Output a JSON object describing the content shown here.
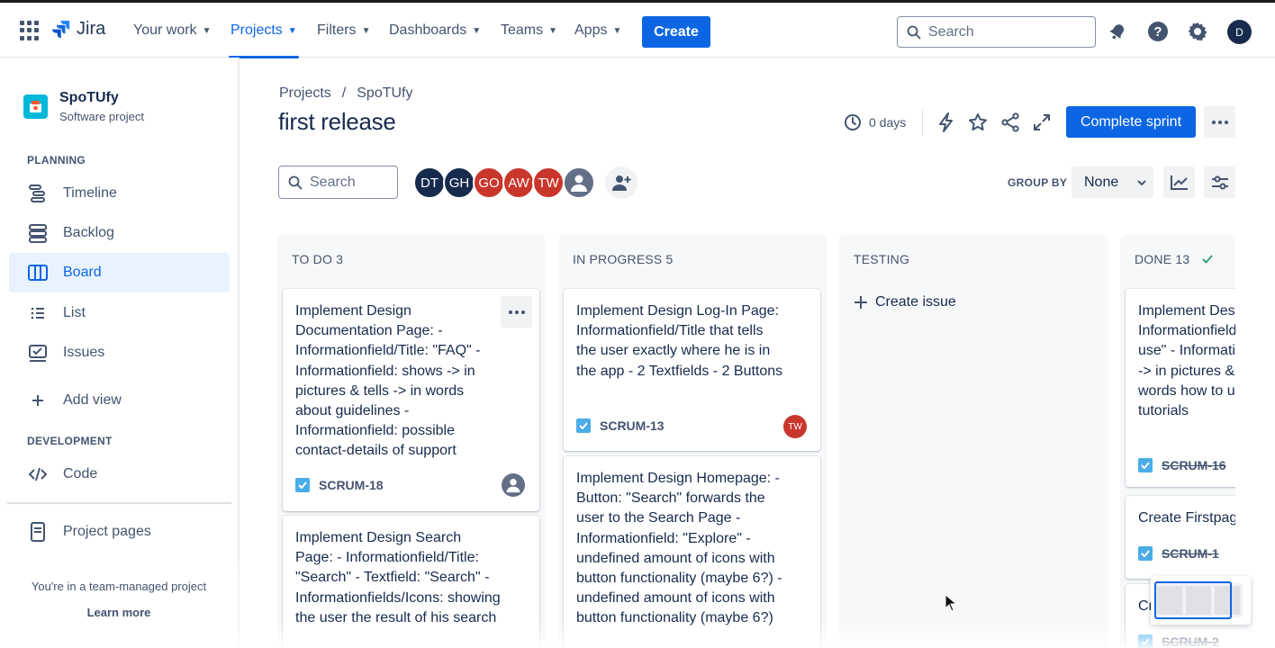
{
  "nav": {
    "logo": "Jira",
    "items": [
      {
        "label": "Your work",
        "active": false
      },
      {
        "label": "Projects",
        "active": true
      },
      {
        "label": "Filters",
        "active": false
      },
      {
        "label": "Dashboards",
        "active": false
      },
      {
        "label": "Teams",
        "active": false
      },
      {
        "label": "Apps",
        "active": false
      }
    ],
    "create_label": "Create",
    "search_placeholder": "Search",
    "avatar_initial": "D",
    "icons": [
      "notifications-icon",
      "help-icon",
      "settings-icon"
    ]
  },
  "sidebar": {
    "project_name": "SpoTUfy",
    "project_type": "Software project",
    "planning_title": "PLANNING",
    "planning_items": [
      {
        "label": "Timeline",
        "icon": "timeline-icon"
      },
      {
        "label": "Backlog",
        "icon": "backlog-icon"
      },
      {
        "label": "Board",
        "icon": "board-icon",
        "active": true
      },
      {
        "label": "List",
        "icon": "list-icon"
      },
      {
        "label": "Issues",
        "icon": "issues-icon"
      }
    ],
    "add_view": "Add view",
    "development_title": "DEVELOPMENT",
    "code": "Code",
    "project_pages": "Project pages",
    "team_note": "You're in a team-managed project",
    "learn_more": "Learn more"
  },
  "header": {
    "breadcrumb_projects": "Projects",
    "breadcrumb_sep": "/",
    "breadcrumb_project": "SpoTUfy",
    "title": "first release",
    "days": "0 days",
    "complete_sprint": "Complete sprint"
  },
  "filters": {
    "search_placeholder": "Search",
    "avatars": [
      {
        "initials": "DT",
        "color": "#172b4d"
      },
      {
        "initials": "GH",
        "color": "#172b4d"
      },
      {
        "initials": "GO",
        "color": "#c9372c"
      },
      {
        "initials": "AW",
        "color": "#c9372c"
      },
      {
        "initials": "TW",
        "color": "#c9372c"
      }
    ],
    "group_by_label": "GROUP BY",
    "group_by_value": "None"
  },
  "columns": [
    {
      "title": "TO DO 3",
      "cards": [
        {
          "text": "Implement Design Documentation Page: - Informationfield/Title: \"FAQ\" - Informationfield: shows -> in pictures & tells -> in words about guidelines - Informationfield: possible contact-details of support",
          "key": "SCRUM-18",
          "assignee": "unassigned"
        },
        {
          "text": "Implement Design Search Page: - Informationfield/Title: \"Search\" - Textfield: \"Search\" - Informationfields/Icons: showing the user the result of his search",
          "key": "",
          "assignee": ""
        }
      ]
    },
    {
      "title": "IN PROGRESS 5",
      "cards": [
        {
          "text": "Implement Design Log-In Page: Informationfield/Title that tells the user exactly where he is in the app - 2 Textfields - 2 Buttons",
          "key": "SCRUM-13",
          "assignee": "TW"
        },
        {
          "text": "Implement Design Homepage: - Button: \"Search\" forwards the user to the Search Page - Informationfield: \"Explore\" - undefined amount of icons with button functionality (maybe 6?) - undefined amount of icons with button functionality (maybe 6?)",
          "key": "",
          "assignee": ""
        }
      ]
    },
    {
      "title": "TESTING",
      "create_issue": "Create issue",
      "cards": []
    },
    {
      "title": "DONE 13",
      "cards": [
        {
          "text": "Implement Design Page: - Informationfield/Title: \"How to use\" - Informationfield: shows -> in pictures & tells -> in words how to use the app - tutorials",
          "key": "SCRUM-16"
        },
        {
          "text": "Create Firstpage",
          "key": "SCRUM-1"
        },
        {
          "text": "Cr",
          "key": "SCRUM-2"
        }
      ]
    }
  ]
}
